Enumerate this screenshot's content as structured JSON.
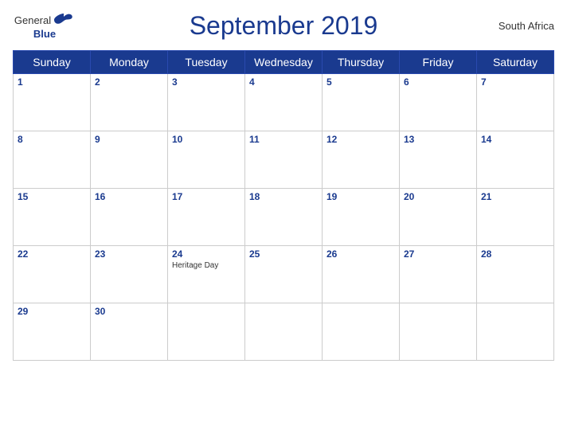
{
  "header": {
    "logo_general": "General",
    "logo_blue": "Blue",
    "title": "September 2019",
    "country": "South Africa"
  },
  "weekdays": [
    "Sunday",
    "Monday",
    "Tuesday",
    "Wednesday",
    "Thursday",
    "Friday",
    "Saturday"
  ],
  "weeks": [
    [
      {
        "date": "1",
        "event": ""
      },
      {
        "date": "2",
        "event": ""
      },
      {
        "date": "3",
        "event": ""
      },
      {
        "date": "4",
        "event": ""
      },
      {
        "date": "5",
        "event": ""
      },
      {
        "date": "6",
        "event": ""
      },
      {
        "date": "7",
        "event": ""
      }
    ],
    [
      {
        "date": "8",
        "event": ""
      },
      {
        "date": "9",
        "event": ""
      },
      {
        "date": "10",
        "event": ""
      },
      {
        "date": "11",
        "event": ""
      },
      {
        "date": "12",
        "event": ""
      },
      {
        "date": "13",
        "event": ""
      },
      {
        "date": "14",
        "event": ""
      }
    ],
    [
      {
        "date": "15",
        "event": ""
      },
      {
        "date": "16",
        "event": ""
      },
      {
        "date": "17",
        "event": ""
      },
      {
        "date": "18",
        "event": ""
      },
      {
        "date": "19",
        "event": ""
      },
      {
        "date": "20",
        "event": ""
      },
      {
        "date": "21",
        "event": ""
      }
    ],
    [
      {
        "date": "22",
        "event": ""
      },
      {
        "date": "23",
        "event": ""
      },
      {
        "date": "24",
        "event": "Heritage Day"
      },
      {
        "date": "25",
        "event": ""
      },
      {
        "date": "26",
        "event": ""
      },
      {
        "date": "27",
        "event": ""
      },
      {
        "date": "28",
        "event": ""
      }
    ],
    [
      {
        "date": "29",
        "event": ""
      },
      {
        "date": "30",
        "event": ""
      },
      {
        "date": "",
        "event": ""
      },
      {
        "date": "",
        "event": ""
      },
      {
        "date": "",
        "event": ""
      },
      {
        "date": "",
        "event": ""
      },
      {
        "date": "",
        "event": ""
      }
    ]
  ]
}
